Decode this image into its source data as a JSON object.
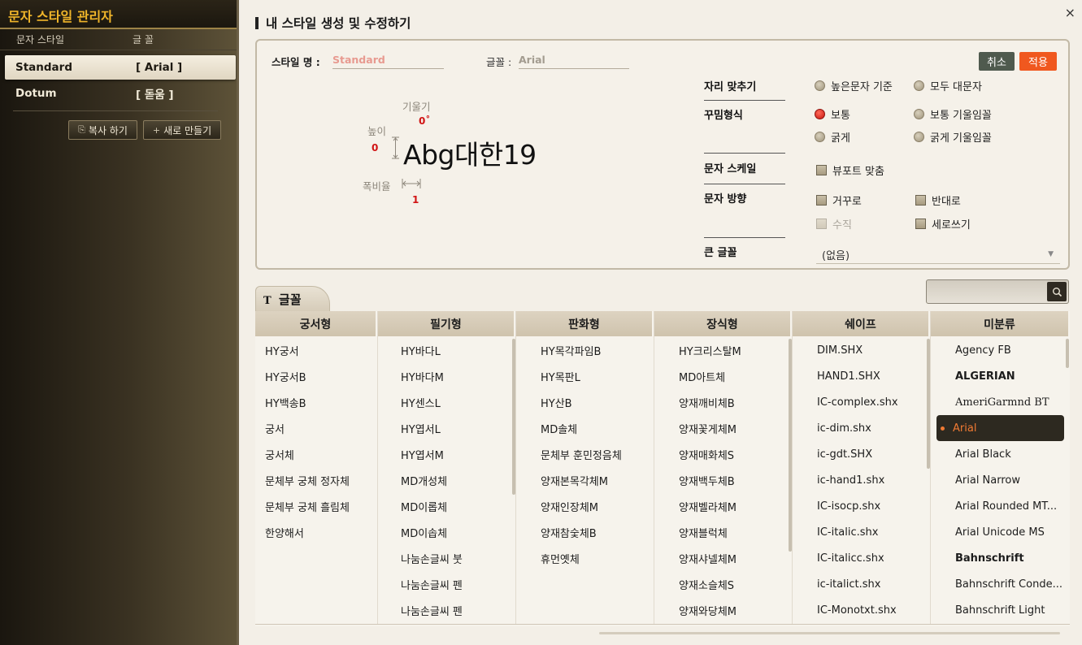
{
  "left_panel": {
    "title": "문자 스타일 관리자",
    "col_style": "문자 스타일",
    "col_font": "글 꼴",
    "styles": [
      {
        "name": "Standard",
        "font": "[ Arial ]"
      },
      {
        "name": "Dotum",
        "font": "[ 돋움 ]"
      }
    ],
    "copy_button": "복사 하기",
    "new_button": "새로 만들기"
  },
  "main": {
    "close": "×",
    "title": "내 스타일 생성 및 수정하기",
    "style_name_label": "스타일 명 :",
    "style_name_value": "Standard",
    "font_label": "글꼴 :",
    "font_value": "Arial",
    "cancel": "취소",
    "apply": "적용",
    "preview": {
      "tilt_label": "기울기",
      "tilt_value": "0˚",
      "height_label": "높이",
      "height_value": "0",
      "width_ratio_label": "폭비율",
      "width_ratio_value": "1",
      "sample": "Abg대한19"
    },
    "options": {
      "justify_label": "자리 맞추기",
      "justify_opts": [
        "높은문자 기준",
        "모두 대문자"
      ],
      "decor_label": "꾸밈형식",
      "decor_opts": [
        "보통",
        "보통 기울임꼴",
        "굵게",
        "굵게 기울임꼴"
      ],
      "scale_label": "문자 스케일",
      "scale_opt": "뷰포트 맞춤",
      "dir_label": "문자 방향",
      "dir_opts": [
        "거꾸로",
        "반대로",
        "수직",
        "세로쓰기"
      ],
      "big_font_label": "큰 글꼴",
      "big_font_value": "(없음)"
    }
  },
  "font_tab": {
    "icon": "T",
    "label": "글꼴",
    "search_placeholder": ""
  },
  "font_columns": [
    {
      "header": "궁서형",
      "items": [
        "HY궁서",
        "HY궁서B",
        "HY백송B",
        "궁서",
        "궁서체",
        "문체부 궁체 정자체",
        "문체부 궁체 흘림체",
        "한양해서"
      ]
    },
    {
      "header": "필기형",
      "items": [
        "HY바다L",
        "HY바다M",
        "HY센스L",
        "HY엽서L",
        "HY엽서M",
        "MD개성체",
        "MD이롭체",
        "MD이솝체",
        "나눔손글씨 붓",
        "나눔손글씨 펜",
        "나눔손글씨 펜"
      ]
    },
    {
      "header": "판화형",
      "items": [
        "HY목각파임B",
        "HY목판L",
        "HY산B",
        "MD솔체",
        "문체부 훈민정음체",
        "양재본목각체M",
        "양재인장체M",
        "양재참숯체B",
        "휴먼옛체"
      ]
    },
    {
      "header": "장식형",
      "items": [
        "HY크리스탈M",
        "MD아트체",
        "양재깨비체B",
        "양재꽃게체M",
        "양재매화체S",
        "양재백두체B",
        "양재벨라체M",
        "양재블럭체",
        "양재샤넬체M",
        "양재소슬체S",
        "양재와당체M"
      ]
    },
    {
      "header": "쉐이프",
      "items": [
        "DIM.SHX",
        "HAND1.SHX",
        "IC-complex.shx",
        "ic-dim.shx",
        "ic-gdt.SHX",
        "ic-hand1.shx",
        "IC-isocp.shx",
        "IC-italic.shx",
        "IC-italicc.shx",
        "ic-italict.shx",
        "IC-Monotxt.shx"
      ]
    },
    {
      "header": "미분류",
      "items": [
        "Agency FB",
        "ALGERIAN",
        "AmeriGarmnd BT",
        "Arial",
        "Arial Black",
        "Arial Narrow",
        "Arial Rounded MT...",
        "Arial Unicode MS",
        "Bahnschrift",
        "Bahnschrift Conde...",
        "Bahnschrift Light"
      ],
      "selected": 3
    }
  ]
}
